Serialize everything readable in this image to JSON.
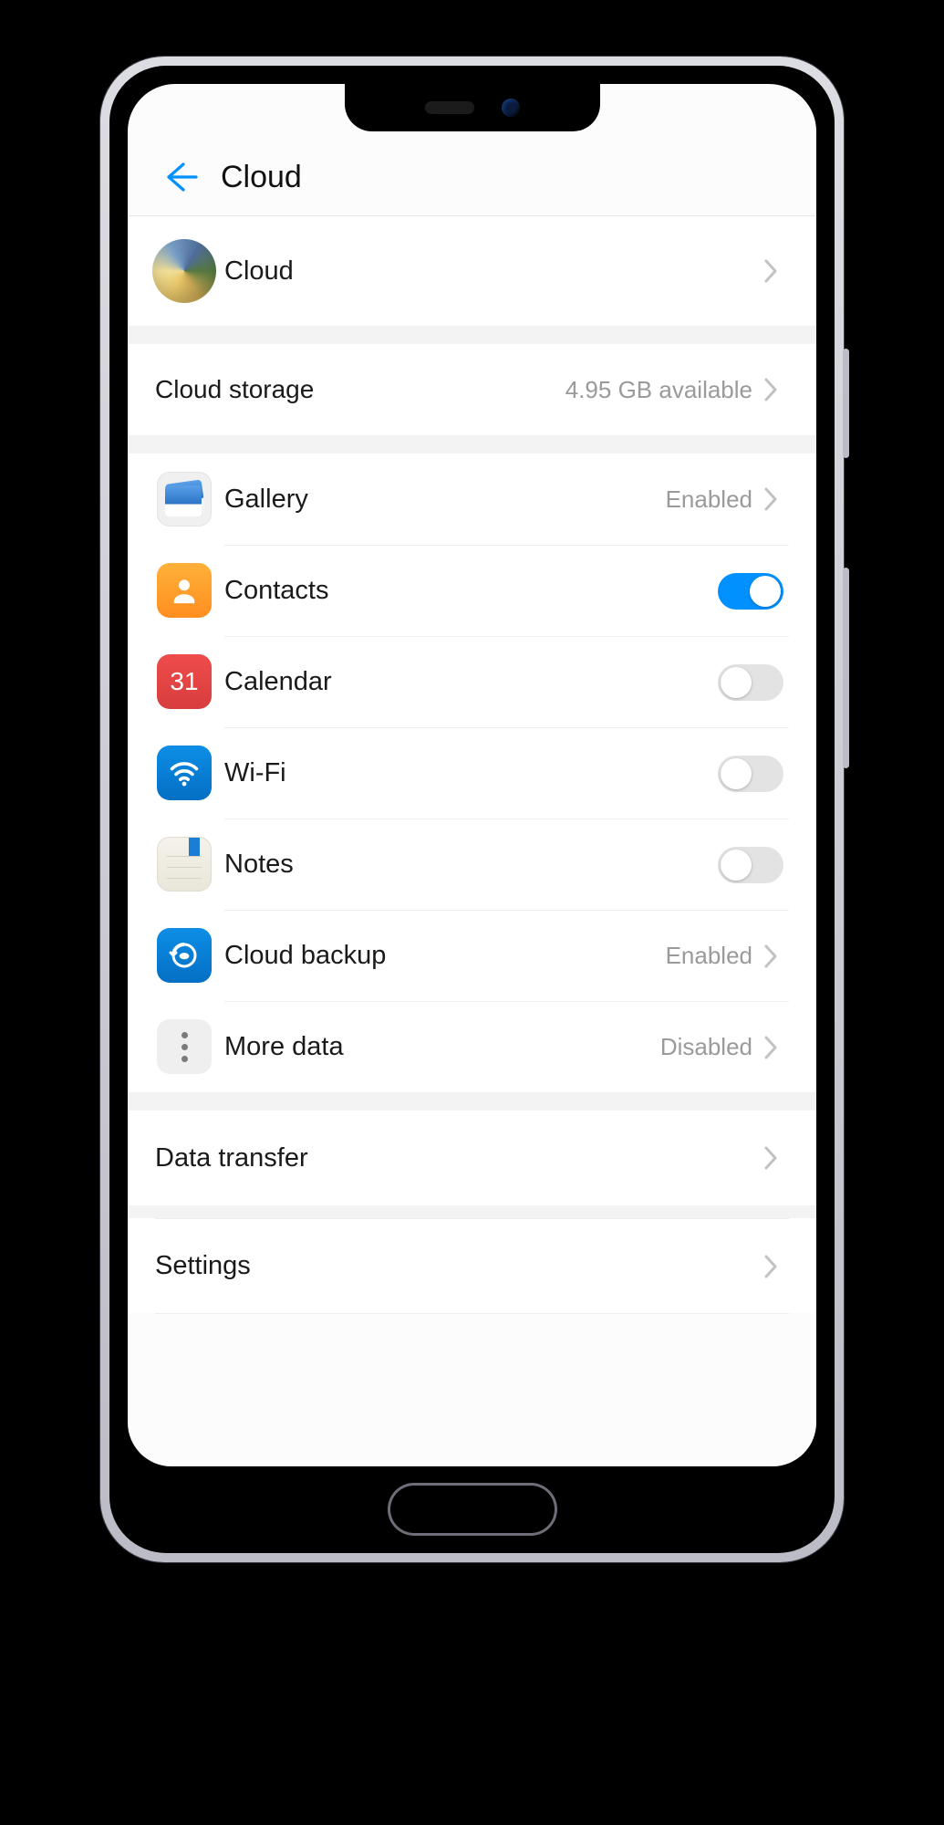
{
  "nav": {
    "title": "Cloud"
  },
  "profile": {
    "label": "Cloud"
  },
  "storage": {
    "label": "Cloud storage",
    "value": "4.95 GB available"
  },
  "items": [
    {
      "label": "Gallery",
      "type": "link",
      "status": "Enabled",
      "icon": "gallery"
    },
    {
      "label": "Contacts",
      "type": "toggle",
      "on": true,
      "icon": "contacts"
    },
    {
      "label": "Calendar",
      "type": "toggle",
      "on": false,
      "icon": "calendar",
      "day": "31"
    },
    {
      "label": "Wi-Fi",
      "type": "toggle",
      "on": false,
      "icon": "wifi"
    },
    {
      "label": "Notes",
      "type": "toggle",
      "on": false,
      "icon": "notes"
    },
    {
      "label": "Cloud backup",
      "type": "link",
      "status": "Enabled",
      "icon": "backup"
    },
    {
      "label": "More data",
      "type": "link",
      "status": "Disabled",
      "icon": "more"
    }
  ],
  "footer": [
    {
      "label": "Data transfer"
    },
    {
      "label": "Settings"
    }
  ]
}
